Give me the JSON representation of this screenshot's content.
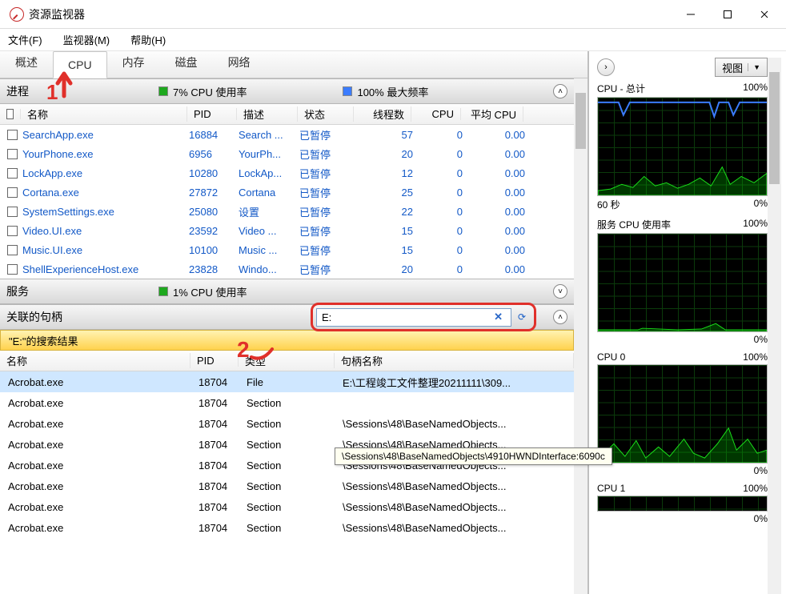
{
  "window": {
    "title": "资源监视器"
  },
  "menu": {
    "file": "文件(F)",
    "monitor": "监视器(M)",
    "help": "帮助(H)"
  },
  "tabs": {
    "overview": "概述",
    "cpu": "CPU",
    "memory": "内存",
    "disk": "磁盘",
    "network": "网络"
  },
  "proc_section": {
    "title": "进程",
    "usage": "7% CPU 使用率",
    "maxfreq": "100% 最大频率"
  },
  "proc_cols": {
    "name": "名称",
    "pid": "PID",
    "desc": "描述",
    "status": "状态",
    "threads": "线程数",
    "cpu": "CPU",
    "avg": "平均 CPU"
  },
  "processes": [
    {
      "name": "SearchApp.exe",
      "pid": "16884",
      "desc": "Search ...",
      "status": "已暂停",
      "threads": "57",
      "cpu": "0",
      "avg": "0.00"
    },
    {
      "name": "YourPhone.exe",
      "pid": "6956",
      "desc": "YourPh...",
      "status": "已暂停",
      "threads": "20",
      "cpu": "0",
      "avg": "0.00"
    },
    {
      "name": "LockApp.exe",
      "pid": "10280",
      "desc": "LockAp...",
      "status": "已暂停",
      "threads": "12",
      "cpu": "0",
      "avg": "0.00"
    },
    {
      "name": "Cortana.exe",
      "pid": "27872",
      "desc": "Cortana",
      "status": "已暂停",
      "threads": "25",
      "cpu": "0",
      "avg": "0.00"
    },
    {
      "name": "SystemSettings.exe",
      "pid": "25080",
      "desc": "设置",
      "status": "已暂停",
      "threads": "22",
      "cpu": "0",
      "avg": "0.00"
    },
    {
      "name": "Video.UI.exe",
      "pid": "23592",
      "desc": "Video ...",
      "status": "已暂停",
      "threads": "15",
      "cpu": "0",
      "avg": "0.00"
    },
    {
      "name": "Music.UI.exe",
      "pid": "10100",
      "desc": "Music ...",
      "status": "已暂停",
      "threads": "15",
      "cpu": "0",
      "avg": "0.00"
    },
    {
      "name": "ShellExperienceHost.exe",
      "pid": "23828",
      "desc": "Windo...",
      "status": "已暂停",
      "threads": "20",
      "cpu": "0",
      "avg": "0.00"
    }
  ],
  "svc_section": {
    "title": "服务",
    "usage": "1% CPU 使用率"
  },
  "handles_section": {
    "title": "关联的句柄",
    "search_value": "E:"
  },
  "search_banner": "\"E:\"的搜索结果",
  "handle_cols": {
    "name": "名称",
    "pid": "PID",
    "type": "类型",
    "hname": "句柄名称"
  },
  "handles": [
    {
      "name": "Acrobat.exe",
      "pid": "18704",
      "type": "File",
      "hname": "E:\\工程竣工文件整理20211111\\309..."
    },
    {
      "name": "Acrobat.exe",
      "pid": "18704",
      "type": "Section",
      "hname": ""
    },
    {
      "name": "Acrobat.exe",
      "pid": "18704",
      "type": "Section",
      "hname": "\\Sessions\\48\\BaseNamedObjects..."
    },
    {
      "name": "Acrobat.exe",
      "pid": "18704",
      "type": "Section",
      "hname": "\\Sessions\\48\\BaseNamedObjects..."
    },
    {
      "name": "Acrobat.exe",
      "pid": "18704",
      "type": "Section",
      "hname": "\\Sessions\\48\\BaseNamedObjects..."
    },
    {
      "name": "Acrobat.exe",
      "pid": "18704",
      "type": "Section",
      "hname": "\\Sessions\\48\\BaseNamedObjects..."
    },
    {
      "name": "Acrobat.exe",
      "pid": "18704",
      "type": "Section",
      "hname": "\\Sessions\\48\\BaseNamedObjects..."
    },
    {
      "name": "Acrobat.exe",
      "pid": "18704",
      "type": "Section",
      "hname": "\\Sessions\\48\\BaseNamedObjects..."
    }
  ],
  "tooltip": "\\Sessions\\48\\BaseNamedObjects\\4910HWNDInterface:6090c",
  "rightpane": {
    "view_label": "视图"
  },
  "charts": [
    {
      "title_left": "CPU - 总计",
      "title_right": "100%",
      "footer_left": "60 秒",
      "footer_right": "0%"
    },
    {
      "title_left": "服务 CPU 使用率",
      "title_right": "100%",
      "footer_left": "",
      "footer_right": "0%"
    },
    {
      "title_left": "CPU 0",
      "title_right": "100%",
      "footer_left": "",
      "footer_right": "0%"
    },
    {
      "title_left": "CPU 1",
      "title_right": "100%",
      "footer_left": "",
      "footer_right": "0%"
    }
  ],
  "annotations": {
    "one": "1",
    "two": "2"
  }
}
